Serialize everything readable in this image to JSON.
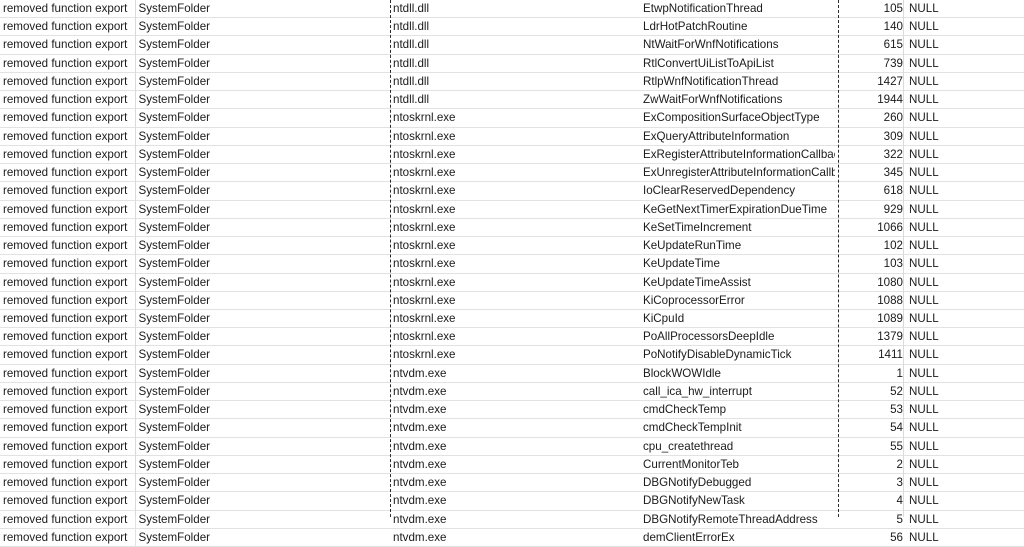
{
  "sheet": {
    "columns": [
      "action",
      "folder",
      "module",
      "function",
      "ordinal",
      "value"
    ],
    "page_break_color": "#2b2b2b",
    "grid_line_color": "#e2e2e2",
    "text_color": "#1b1b1b",
    "row_count": 30
  },
  "rows": [
    {
      "action": "removed function export",
      "folder": "SystemFolder",
      "module": "ntdll.dll",
      "function": "EtwpNotificationThread",
      "ordinal": "105",
      "value": "NULL"
    },
    {
      "action": "removed function export",
      "folder": "SystemFolder",
      "module": "ntdll.dll",
      "function": "LdrHotPatchRoutine",
      "ordinal": "140",
      "value": "NULL"
    },
    {
      "action": "removed function export",
      "folder": "SystemFolder",
      "module": "ntdll.dll",
      "function": "NtWaitForWnfNotifications",
      "ordinal": "615",
      "value": "NULL"
    },
    {
      "action": "removed function export",
      "folder": "SystemFolder",
      "module": "ntdll.dll",
      "function": "RtlConvertUiListToApiList",
      "ordinal": "739",
      "value": "NULL"
    },
    {
      "action": "removed function export",
      "folder": "SystemFolder",
      "module": "ntdll.dll",
      "function": "RtlpWnfNotificationThread",
      "ordinal": "1427",
      "value": "NULL"
    },
    {
      "action": "removed function export",
      "folder": "SystemFolder",
      "module": "ntdll.dll",
      "function": "ZwWaitForWnfNotifications",
      "ordinal": "1944",
      "value": "NULL"
    },
    {
      "action": "removed function export",
      "folder": "SystemFolder",
      "module": "ntoskrnl.exe",
      "function": "ExCompositionSurfaceObjectType",
      "ordinal": "260",
      "value": "NULL"
    },
    {
      "action": "removed function export",
      "folder": "SystemFolder",
      "module": "ntoskrnl.exe",
      "function": "ExQueryAttributeInformation",
      "ordinal": "309",
      "value": "NULL"
    },
    {
      "action": "removed function export",
      "folder": "SystemFolder",
      "module": "ntoskrnl.exe",
      "function": "ExRegisterAttributeInformationCallback",
      "ordinal": "322",
      "value": "NULL"
    },
    {
      "action": "removed function export",
      "folder": "SystemFolder",
      "module": "ntoskrnl.exe",
      "function": "ExUnregisterAttributeInformationCallback",
      "ordinal": "345",
      "value": "NULL"
    },
    {
      "action": "removed function export",
      "folder": "SystemFolder",
      "module": "ntoskrnl.exe",
      "function": "IoClearReservedDependency",
      "ordinal": "618",
      "value": "NULL"
    },
    {
      "action": "removed function export",
      "folder": "SystemFolder",
      "module": "ntoskrnl.exe",
      "function": "KeGetNextTimerExpirationDueTime",
      "ordinal": "929",
      "value": "NULL"
    },
    {
      "action": "removed function export",
      "folder": "SystemFolder",
      "module": "ntoskrnl.exe",
      "function": "KeSetTimeIncrement",
      "ordinal": "1066",
      "value": "NULL"
    },
    {
      "action": "removed function export",
      "folder": "SystemFolder",
      "module": "ntoskrnl.exe",
      "function": "KeUpdateRunTime",
      "ordinal": "102",
      "value": "NULL"
    },
    {
      "action": "removed function export",
      "folder": "SystemFolder",
      "module": "ntoskrnl.exe",
      "function": "KeUpdateTime",
      "ordinal": "103",
      "value": "NULL"
    },
    {
      "action": "removed function export",
      "folder": "SystemFolder",
      "module": "ntoskrnl.exe",
      "function": "KeUpdateTimeAssist",
      "ordinal": "1080",
      "value": "NULL"
    },
    {
      "action": "removed function export",
      "folder": "SystemFolder",
      "module": "ntoskrnl.exe",
      "function": "KiCoprocessorError",
      "ordinal": "1088",
      "value": "NULL"
    },
    {
      "action": "removed function export",
      "folder": "SystemFolder",
      "module": "ntoskrnl.exe",
      "function": "KiCpuId",
      "ordinal": "1089",
      "value": "NULL"
    },
    {
      "action": "removed function export",
      "folder": "SystemFolder",
      "module": "ntoskrnl.exe",
      "function": "PoAllProcessorsDeepIdle",
      "ordinal": "1379",
      "value": "NULL"
    },
    {
      "action": "removed function export",
      "folder": "SystemFolder",
      "module": "ntoskrnl.exe",
      "function": "PoNotifyDisableDynamicTick",
      "ordinal": "1411",
      "value": "NULL"
    },
    {
      "action": "removed function export",
      "folder": "SystemFolder",
      "module": "ntvdm.exe",
      "function": "BlockWOWIdle",
      "ordinal": "1",
      "value": "NULL"
    },
    {
      "action": "removed function export",
      "folder": "SystemFolder",
      "module": "ntvdm.exe",
      "function": "call_ica_hw_interrupt",
      "ordinal": "52",
      "value": "NULL"
    },
    {
      "action": "removed function export",
      "folder": "SystemFolder",
      "module": "ntvdm.exe",
      "function": "cmdCheckTemp",
      "ordinal": "53",
      "value": "NULL"
    },
    {
      "action": "removed function export",
      "folder": "SystemFolder",
      "module": "ntvdm.exe",
      "function": "cmdCheckTempInit",
      "ordinal": "54",
      "value": "NULL"
    },
    {
      "action": "removed function export",
      "folder": "SystemFolder",
      "module": "ntvdm.exe",
      "function": "cpu_createthread",
      "ordinal": "55",
      "value": "NULL"
    },
    {
      "action": "removed function export",
      "folder": "SystemFolder",
      "module": "ntvdm.exe",
      "function": "CurrentMonitorTeb",
      "ordinal": "2",
      "value": "NULL"
    },
    {
      "action": "removed function export",
      "folder": "SystemFolder",
      "module": "ntvdm.exe",
      "function": "DBGNotifyDebugged",
      "ordinal": "3",
      "value": "NULL"
    },
    {
      "action": "removed function export",
      "folder": "SystemFolder",
      "module": "ntvdm.exe",
      "function": "DBGNotifyNewTask",
      "ordinal": "4",
      "value": "NULL"
    },
    {
      "action": "removed function export",
      "folder": "SystemFolder",
      "module": "ntvdm.exe",
      "function": "DBGNotifyRemoteThreadAddress",
      "ordinal": "5",
      "value": "NULL"
    },
    {
      "action": "removed function export",
      "folder": "SystemFolder",
      "module": "ntvdm.exe",
      "function": "demClientErrorEx",
      "ordinal": "56",
      "value": "NULL"
    }
  ]
}
